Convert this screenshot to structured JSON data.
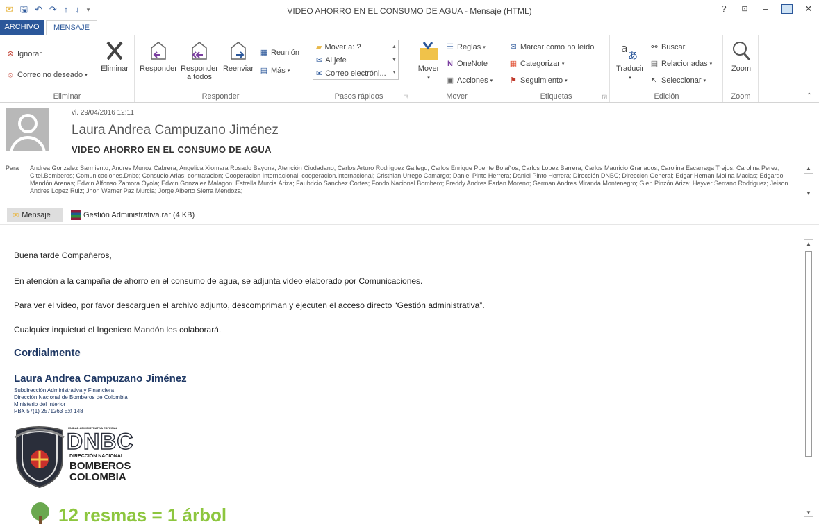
{
  "window": {
    "title": "VIDEO AHORRO EN EL CONSUMO DE AGUA - Mensaje (HTML)",
    "help": "?",
    "minimize": "–",
    "close": "✕"
  },
  "tabs": [
    {
      "label": "ARCHIVO"
    },
    {
      "label": "MENSAJE"
    }
  ],
  "ribbon": {
    "eliminar": {
      "label": "Eliminar",
      "ignorar": "Ignorar",
      "correo_no_deseado": "Correo no deseado",
      "eliminar_btn": "Eliminar"
    },
    "responder": {
      "label": "Responder",
      "responder_btn": "Responder",
      "responder_todos_1": "Responder",
      "responder_todos_2": "a todos",
      "reenviar": "Reenviar",
      "reunion": "Reunión",
      "mas": "Más"
    },
    "pasos_rapidos": {
      "label": "Pasos rápidos",
      "items": [
        "Mover a: ?",
        "Al jefe",
        "Correo electróni..."
      ]
    },
    "mover": {
      "label": "Mover",
      "mover_btn": "Mover",
      "reglas": "Reglas",
      "onenote": "OneNote",
      "acciones": "Acciones"
    },
    "etiquetas": {
      "label": "Etiquetas",
      "marcar": "Marcar como no leído",
      "categorizar": "Categorizar",
      "seguimiento": "Seguimiento"
    },
    "edicion": {
      "label": "Edición",
      "traducir": "Traducir",
      "buscar": "Buscar",
      "relacionadas": "Relacionadas",
      "seleccionar": "Seleccionar"
    },
    "zoom": {
      "label": "Zoom",
      "zoom_btn": "Zoom"
    }
  },
  "message": {
    "date": "vi. 29/04/2016 12:11",
    "sender": "Laura Andrea Campuzano Jiménez",
    "subject": "VIDEO AHORRO EN EL CONSUMO DE AGUA",
    "to_label": "Para",
    "recipients": "Andrea Gonzalez Sarmiento; Andres Munoz Cabrera; Angelica Xiomara Rosado Bayona; Atención  Ciudadano; Carlos Arturo Rodriguez Gallego; Carlos Enrique Puente Bolaños; Carlos Lopez Barrera; Carlos Mauricio  Granados; Carolina Escarraga Trejos; Carolina Perez; Citel.Bomberos; Comunicaciones.Dnbc; Consuelo Arias; contratacion; Cooperacion Internacional; cooperacion.internacional; Cristhian Urrego Camargo; Daniel  Pinto Herrera; Daniel Pinto Herrera; Dirección DNBC; Direccion General; Edgar Hernan Molina Macias; Edgardo Mandón Arenas; Edwin Alfonso Zamora Oyola; Edwin Gonzalez Malagon; Estrella Murcia Ariza; Faubricio Sanchez Cortes; Fondo Nacional Bombero; Freddy Andres Farfan Moreno; German Andres Miranda Montenegro; Glen Pinzón Ariza; Hayver Serrano Rodriguez; Jeison Andres Lopez Ruiz; Jhon Warner Paz Murcia; Jorge Alberto Sierra Mendoza;",
    "attachments": {
      "message_tab": "Mensaje",
      "file": "Gestión Administrativa.rar (4 KB)"
    },
    "body": {
      "greeting": "Buena tarde Compañeros,",
      "p1": "En atención a la campaña de ahorro en el consumo de agua, se adjunta video elaborado por Comunicaciones.",
      "p2": "Para ver el video, por favor descarguen el archivo adjunto, descompriman y ejecuten el acceso directo “Gestión administrativa”.",
      "p3": "Cualquier inquietud el Ingeniero Mandón les colaborará.",
      "closing": "Cordialmente"
    },
    "signature": {
      "name": "Laura Andrea Campuzano Jiménez",
      "line1": "Subdirección Administrativa y Financiera",
      "line2": "Dirección Nacional de Bomberos de Colombia",
      "line3": "Ministerio del Interior",
      "line4": "PBX 57(1) 2571263 Ext 148"
    },
    "logo": {
      "small_top": "UNIDAD ADMINISTRATIVA ESPECIAL",
      "acronym": "DNBC",
      "sub1": "DIRECCIÓN NACIONAL",
      "sub2": "BOMBEROS",
      "sub3": "COLOMBIA",
      "banner": "12 resmas = 1 árbol"
    }
  },
  "colors": {
    "accent": "#2b579a",
    "signature": "#1f3864",
    "banner_green": "#8dc63f"
  }
}
